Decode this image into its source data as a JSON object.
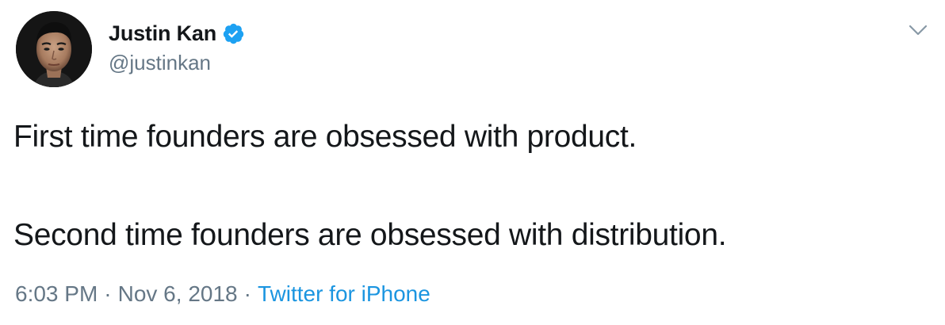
{
  "tweet": {
    "author": {
      "name": "Justin Kan",
      "handle": "@justinkan",
      "verified": true
    },
    "text_lines": [
      "First time founders are obsessed with product.",
      "Second time founders are obsessed with distribution."
    ],
    "meta": {
      "time": "6:03 PM",
      "separator": "·",
      "date": "Nov 6, 2018",
      "source": "Twitter for iPhone"
    }
  },
  "icons": {
    "verified": "verified-badge-icon",
    "menu": "chevron-down-icon"
  },
  "colors": {
    "text": "#14171a",
    "secondary": "#657786",
    "link": "#1b95e0",
    "verified": "#1da1f2"
  }
}
